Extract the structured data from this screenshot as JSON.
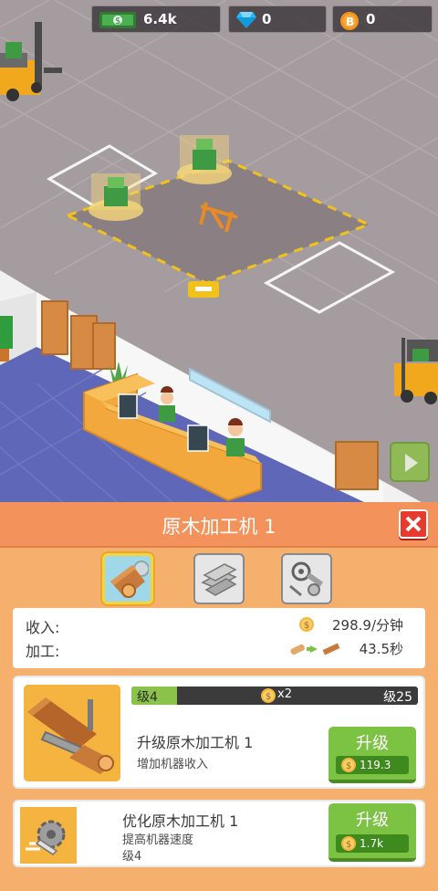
{
  "currencies": {
    "cash": {
      "icon": "cash-icon",
      "value": "6.4k"
    },
    "gems": {
      "icon": "diamond-icon",
      "value": "0"
    },
    "coins": {
      "icon": "bitcoin-icon",
      "value": "0"
    }
  },
  "panel": {
    "title": "原木加工机 1",
    "close_icon": "close-icon",
    "tabs": [
      {
        "icon": "log-saw-icon",
        "active": true
      },
      {
        "icon": "planks-icon",
        "active": false
      },
      {
        "icon": "tools-icon",
        "active": false
      }
    ],
    "stats": {
      "income_label": "收入:",
      "income_value": "298.9/分钟",
      "process_label": "加工:",
      "process_value": "43.5秒"
    },
    "upgrade_card": {
      "level_current": "级4",
      "multiplier": "x2",
      "level_target": "级25",
      "level_progress": 0.16,
      "title": "升级原木加工机 1",
      "subtitle": "增加机器收入",
      "button_label": "升级",
      "price": "119.3"
    },
    "optimize_card": {
      "title": "优化原木加工机 1",
      "subtitle": "提高机器速度",
      "level": "级4",
      "button_label": "升级",
      "price": "1.7k"
    }
  },
  "colors": {
    "panel_header": "#f3925a",
    "panel_bg": "#f6b06e",
    "upgrade_green": "#7cc243",
    "close_red": "#e8392d"
  }
}
